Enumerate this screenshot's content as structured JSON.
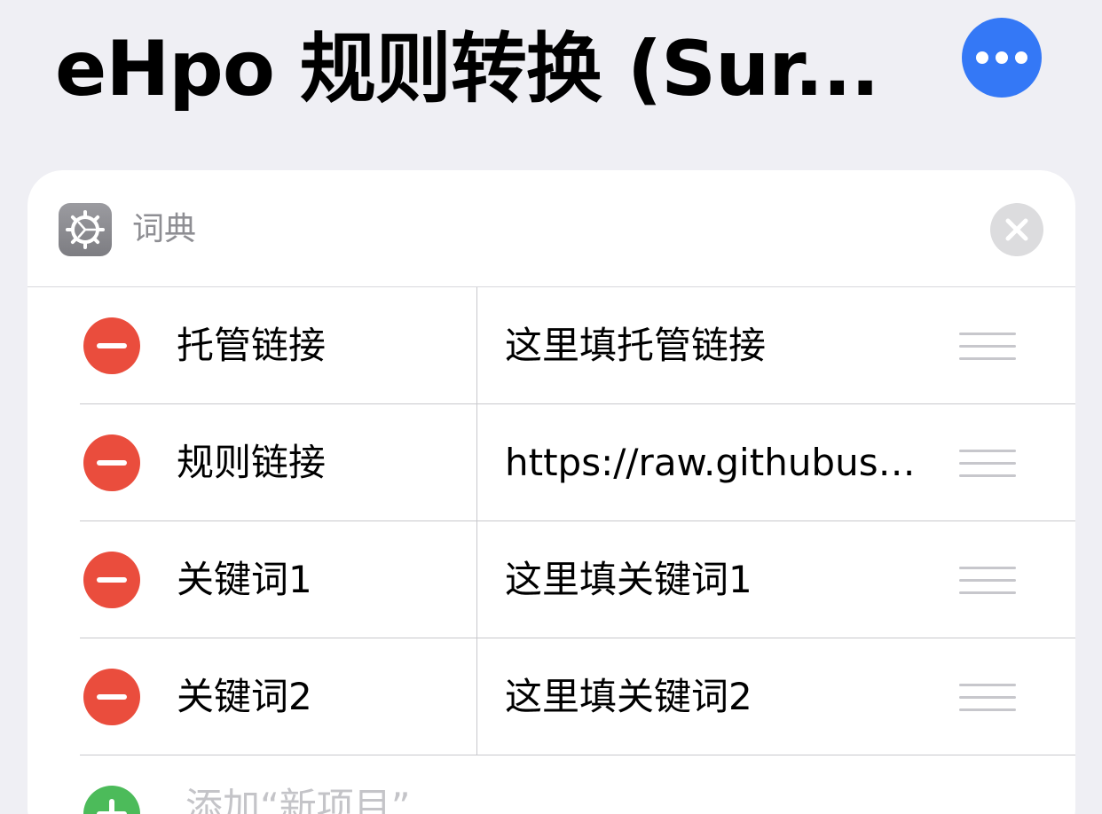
{
  "nav": {
    "title": "eHpo 规则转换 (Sur...",
    "more_icon": "ellipsis-icon",
    "accent_color": "#3478f6"
  },
  "card": {
    "icon": "gear-icon",
    "label": "词典",
    "close_icon": "close-icon"
  },
  "rows": [
    {
      "key": "托管链接",
      "value": "这里填托管链接"
    },
    {
      "key": "规则链接",
      "value": "https://raw.githubuse..."
    },
    {
      "key": "关键词1",
      "value": "这里填关键词1"
    },
    {
      "key": "关键词2",
      "value": "这里填关键词2"
    }
  ],
  "add": {
    "label": "添加“新项目”"
  },
  "colors": {
    "delete": "#ea4d3d",
    "add": "#4cbb5a",
    "background": "#efeff4"
  }
}
